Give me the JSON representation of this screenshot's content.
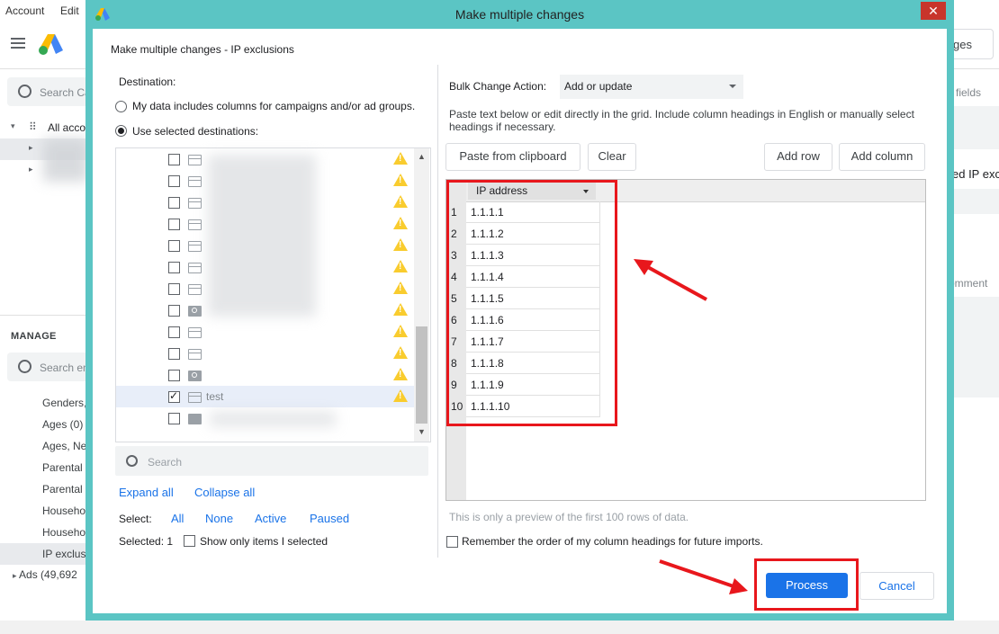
{
  "background": {
    "menu": [
      "Account",
      "Edit"
    ],
    "search_placeholder": "Search Ca",
    "tree_root": "All acco",
    "manage_heading": "MANAGE",
    "search2_placeholder": "Search en",
    "nav_items": [
      "Genders,",
      "Ages (0)",
      "Ages, Ne",
      "Parental",
      "Parental",
      "Househo",
      "Househo",
      "IP exclus"
    ],
    "ads_item": "Ads (49,692",
    "right_button": "ges",
    "right_fields": "fields",
    "right_ip": "ed IP exc",
    "right_comment": "omment"
  },
  "dialog": {
    "title": "Make multiple changes",
    "close_glyph": "✕",
    "subtitle": "Make multiple changes - IP exclusions",
    "destination_label": "Destination:",
    "radio_data": "My data includes columns for campaigns and/or ad groups.",
    "radio_selected": "Use selected destinations:",
    "dest_rows": [
      {
        "type": "campaign",
        "name": "",
        "checked": false
      },
      {
        "type": "campaign",
        "name": "",
        "checked": false
      },
      {
        "type": "campaign",
        "name": "",
        "checked": false
      },
      {
        "type": "campaign",
        "name": "",
        "checked": false
      },
      {
        "type": "campaign",
        "name": "",
        "checked": false
      },
      {
        "type": "search-campaign",
        "name": "",
        "checked": false
      },
      {
        "type": "campaign",
        "name": "",
        "checked": false
      },
      {
        "type": "search",
        "name": "",
        "checked": false
      },
      {
        "type": "campaign",
        "name": "",
        "checked": false
      },
      {
        "type": "campaign",
        "name": "",
        "checked": false
      },
      {
        "type": "search",
        "name": "",
        "checked": false
      },
      {
        "type": "campaign",
        "name": "test",
        "checked": true
      },
      {
        "type": "video",
        "name": "",
        "checked": false
      }
    ],
    "search_placeholder": "Search",
    "expand_all": "Expand all",
    "collapse_all": "Collapse all",
    "select_label": "Select:",
    "select_options": [
      "All",
      "None",
      "Active",
      "Paused"
    ],
    "selected_count": "Selected: 1",
    "show_only_selected": "Show only items I selected",
    "bulk_action_label": "Bulk Change Action:",
    "bulk_action_value": "Add or update",
    "instructions": "Paste text below or edit directly in the grid. Include column headings in English or manually select headings if necessary.",
    "buttons": {
      "paste": "Paste from clipboard",
      "clear": "Clear",
      "add_row": "Add row",
      "add_column": "Add column"
    },
    "grid": {
      "column_header": "IP address",
      "rows": [
        "1.1.1.1",
        "1.1.1.2",
        "1.1.1.3",
        "1.1.1.4",
        "1.1.1.5",
        "1.1.1.6",
        "1.1.1.7",
        "1.1.1.8",
        "1.1.1.9",
        "1.1.1.10"
      ],
      "row_numbers": [
        "1",
        "2",
        "3",
        "4",
        "5",
        "6",
        "7",
        "8",
        "9",
        "10"
      ]
    },
    "preview_note": "This is only a preview of the first 100 rows of data.",
    "remember_label": "Remember the order of my column headings for future imports.",
    "process": "Process",
    "cancel": "Cancel"
  },
  "colors": {
    "dialog_frame": "#5bc5c4",
    "primary": "#1a73e8",
    "annotation": "#e8171c",
    "warning": "#f9cc2e"
  }
}
